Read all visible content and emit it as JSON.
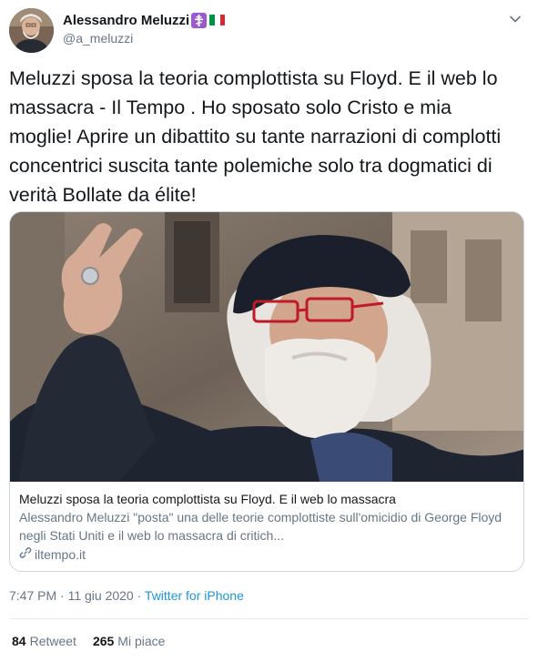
{
  "user": {
    "display_name": "Alessandro Meluzzi",
    "handle": "@a_meluzzi",
    "badge_icon": "orthodox-cross-emoji",
    "flag_icon": "italy-flag-emoji"
  },
  "tweet": {
    "text": "Meluzzi sposa la teoria complottista su Floyd. E il web lo massacra - Il Tempo . Ho sposato solo Cristo e mia moglie! Aprire un dibattito su tante narrazioni di complotti concentrici suscita tante polemiche solo tra dogmatici di verità Bollate da élite!"
  },
  "card": {
    "title": "Meluzzi sposa la teoria complottista su Floyd. E il web lo massacra",
    "description": "Alessandro Meluzzi \"posta\" una delle teorie complottiste sull'omicidio di George Floyd negli Stati Uniti e il web lo massacra di critich...",
    "domain": "iltempo.it"
  },
  "meta": {
    "timestamp": "7:47 PM · 11 giu 2020 · ",
    "source": "Twitter for iPhone"
  },
  "stats": {
    "retweets_count": "84",
    "retweets_label": "Retweet",
    "likes_count": "265",
    "likes_label": "Mi piace"
  },
  "colors": {
    "link": "#1b95e0",
    "secondary": "#657786",
    "primary_text": "#14171a",
    "border": "#ccd6dd"
  }
}
